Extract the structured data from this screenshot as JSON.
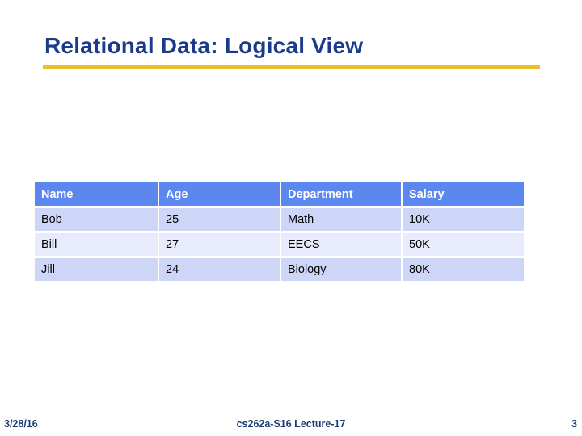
{
  "slide": {
    "title": "Relational Data: Logical View",
    "accent_rule_color": "#eebe2a",
    "title_color": "#1b3a8c"
  },
  "table": {
    "header_bg": "#5b87ef",
    "row_odd_bg": "#ced6f8",
    "row_even_bg": "#e8ebfc",
    "columns": [
      "Name",
      "Age",
      "Department",
      "Salary"
    ],
    "rows": [
      {
        "name": "Bob",
        "age": "25",
        "department": "Math",
        "salary": "10K"
      },
      {
        "name": "Bill",
        "age": "27",
        "department": "EECS",
        "salary": "50K"
      },
      {
        "name": "Jill",
        "age": "24",
        "department": "Biology",
        "salary": "80K"
      }
    ]
  },
  "footer": {
    "date": "3/28/16",
    "center": "cs262a-S16 Lecture-17",
    "page_number": "3",
    "color": "#1b3a73"
  }
}
